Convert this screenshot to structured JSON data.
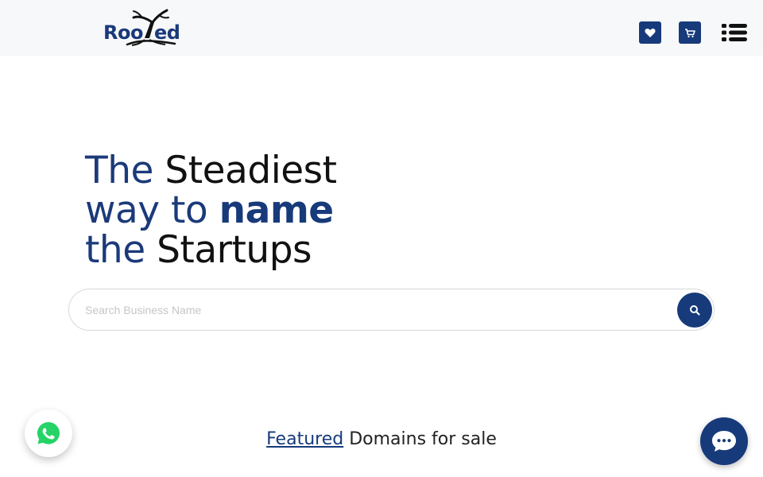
{
  "brand": {
    "name": "Rooted",
    "text_part_1": "Roo",
    "text_part_2": "ed",
    "color": "#1b3a7a"
  },
  "header": {
    "icons": [
      "heart-icon",
      "cart-icon",
      "menu-icon"
    ],
    "bg": "#f7f8fa"
  },
  "hero": {
    "line1_a": "The",
    "line1_b": "Steadiest",
    "line2_a": "way to",
    "line2_b": "name",
    "line3_a": "the",
    "line3_b": "Startups"
  },
  "search": {
    "placeholder": "Search Business Name",
    "value": "",
    "icon": "search-icon"
  },
  "featured": {
    "link_text": "Featured",
    "rest_text": "Domains for sale"
  },
  "floating": {
    "whatsapp_icon": "whatsapp-icon",
    "chat_icon": "chat-icon"
  },
  "colors": {
    "primary": "#173a7a",
    "text_dark": "#111111",
    "whatsapp_green": "#25d366"
  }
}
